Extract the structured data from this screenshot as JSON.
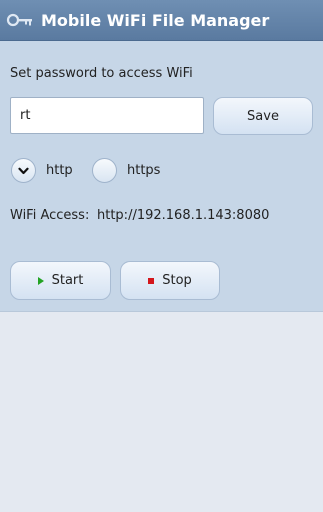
{
  "app": {
    "title": "Mobile WiFi File Manager",
    "icon": "key-icon"
  },
  "password": {
    "prompt": "Set password to access WiFi",
    "value": "rt",
    "save_label": "Save"
  },
  "protocol": {
    "options": [
      {
        "label": "http",
        "checked": true
      },
      {
        "label": "https",
        "checked": false
      }
    ]
  },
  "wifi": {
    "access_label": "WiFi Access:",
    "url": "http://192.168.1.143:8080"
  },
  "controls": {
    "start_label": "Start",
    "stop_label": "Stop",
    "start_icon": "play-icon",
    "stop_icon": "stop-icon"
  },
  "colors": {
    "titlebar": "#6482a6",
    "panel": "#c6d6e7",
    "background": "#e4e9f1",
    "start_green": "#23a323",
    "stop_red": "#d4161b"
  }
}
